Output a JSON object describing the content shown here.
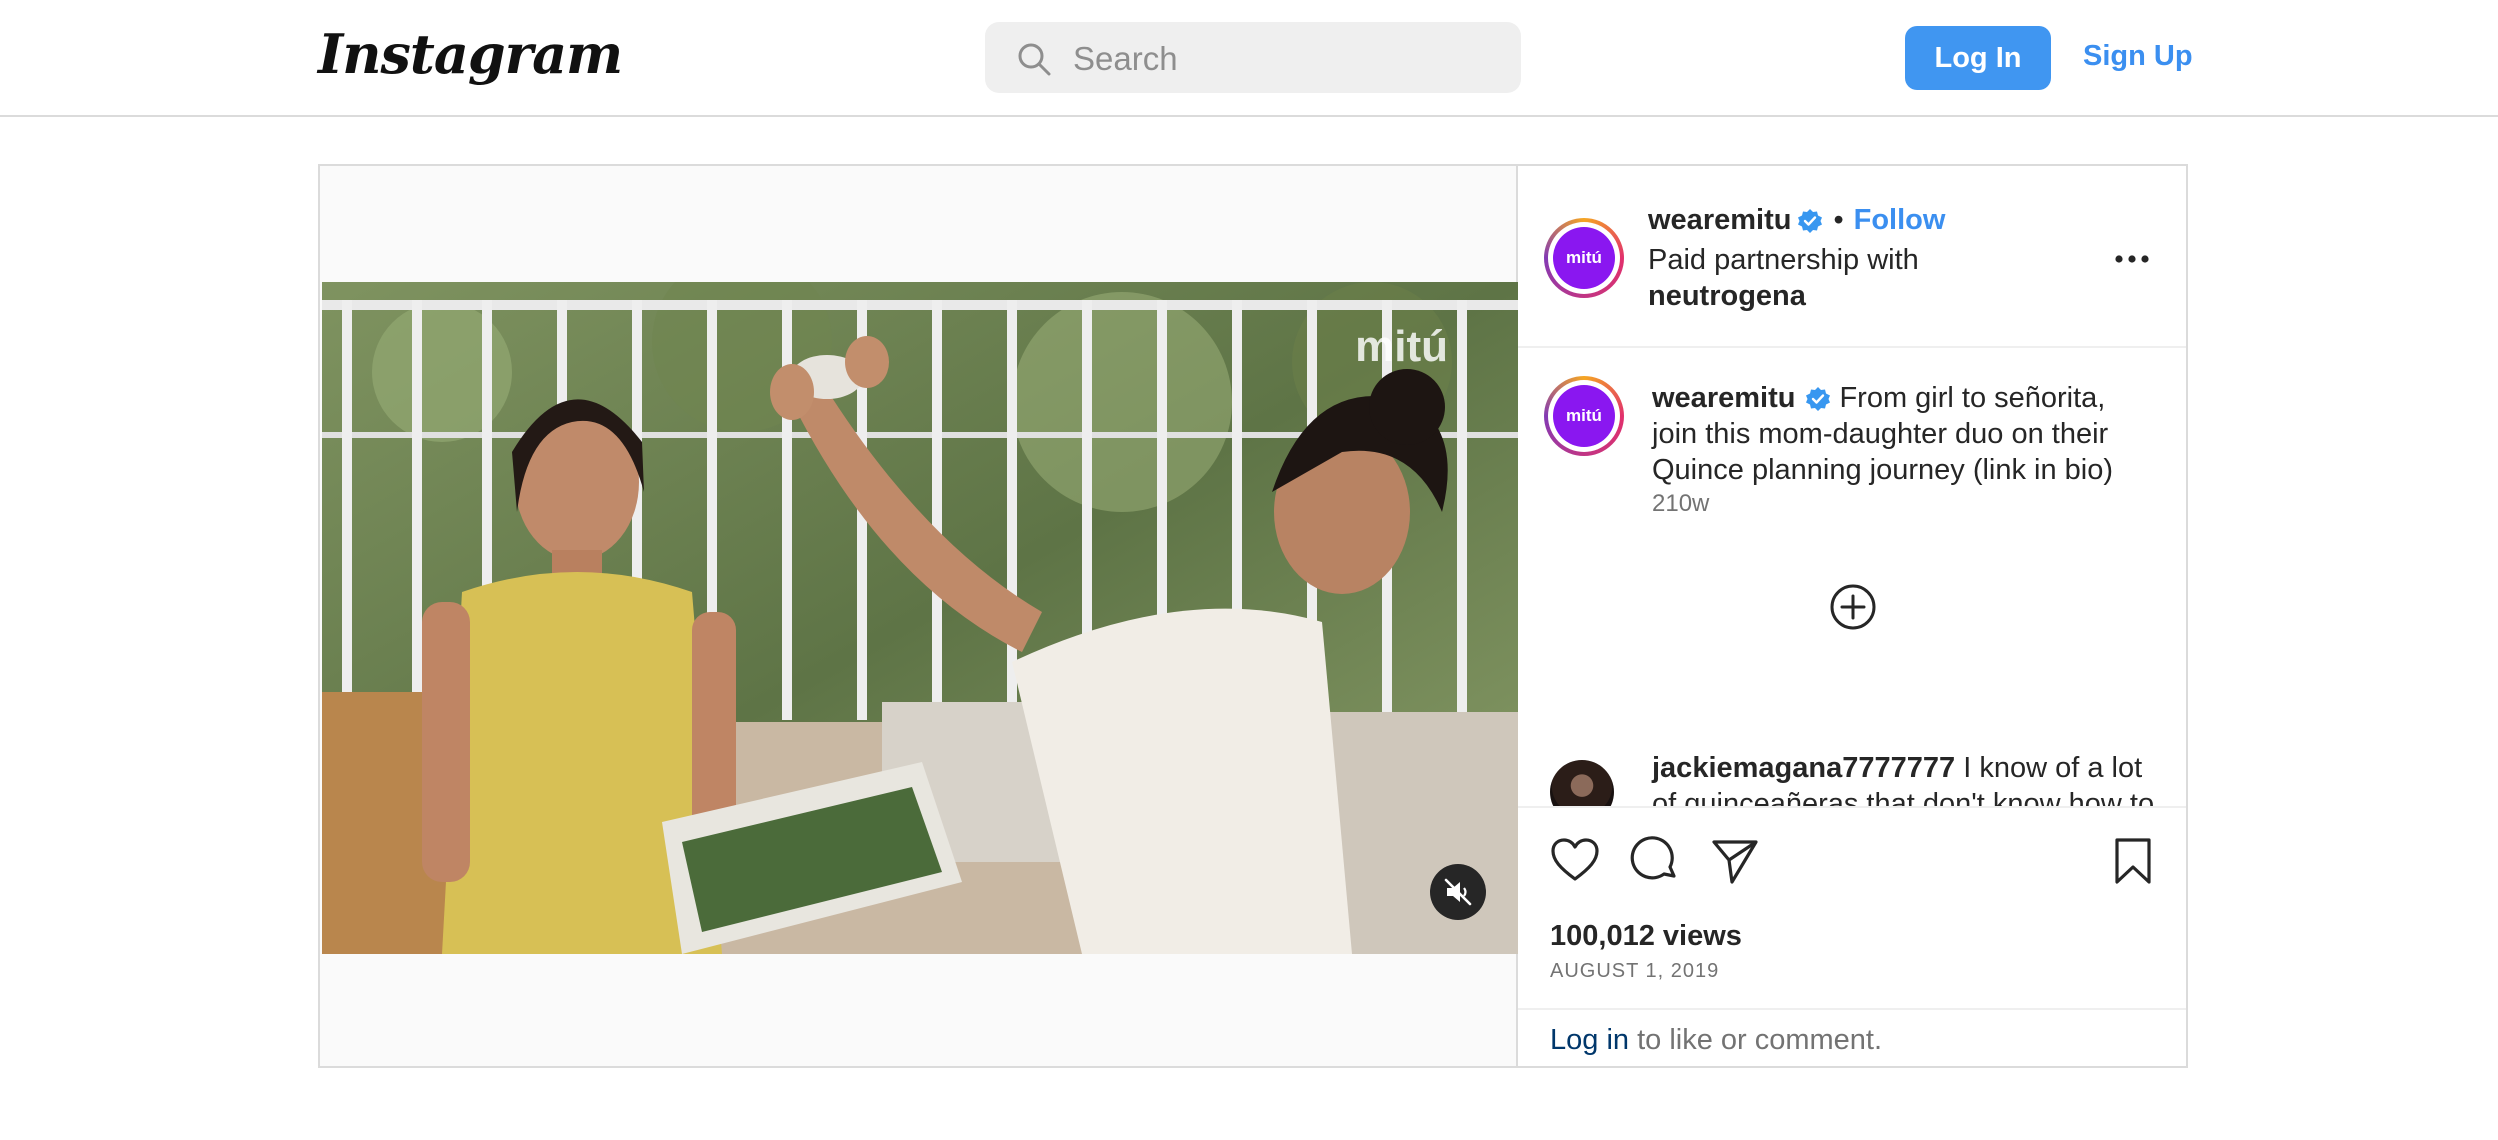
{
  "header": {
    "logo_text": "Instagram",
    "search_placeholder": "Search",
    "login_label": "Log In",
    "signup_label": "Sign Up"
  },
  "post": {
    "video_watermark": "mitú",
    "author": {
      "username": "wearemitu",
      "avatar_text": "mitú",
      "verified": true,
      "follow_label": "Follow",
      "separator": "•"
    },
    "partnership": {
      "prefix": "Paid partnership with",
      "partner": "neutrogena"
    },
    "caption": {
      "username": "wearemitu",
      "text": "From girl to señorita, join this mom-daughter duo on their Quince planning journey (link in bio)",
      "age": "210w"
    },
    "comments": [
      {
        "username": "jackiemagana7777777",
        "text": "I know of a lot of quinceañeras that don't know how to cook and don't even know how to"
      }
    ],
    "stats": {
      "views": "100,012 views",
      "date": "AUGUST 1, 2019"
    },
    "login_prompt": {
      "link": "Log in",
      "rest": " to like or comment."
    }
  },
  "colors": {
    "accent_blue": "#4096f1",
    "avatar_purple": "#8a17f0"
  },
  "icons": [
    "search-icon",
    "verified-badge-icon",
    "more-options-icon",
    "load-more-comments-icon",
    "mute-icon",
    "like-heart-icon",
    "comment-icon",
    "share-icon",
    "save-bookmark-icon"
  ]
}
